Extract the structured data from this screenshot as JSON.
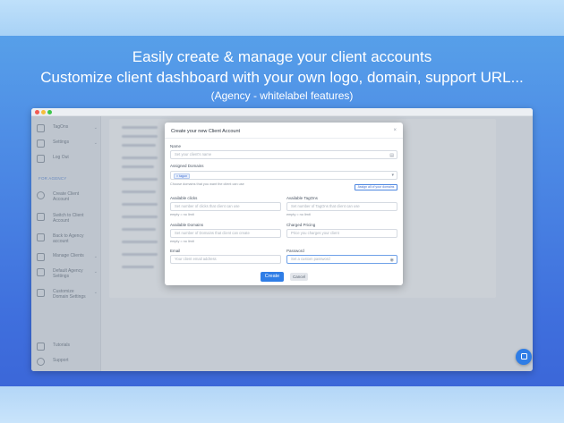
{
  "headline": {
    "line1": "Easily create & manage your client accounts",
    "line2": "Customize client dashboard with your own logo, domain, support URL...",
    "line3": "(Agency - whitelabel features)"
  },
  "sidebar": {
    "items_top": [
      {
        "label": "TagOns",
        "icon": "tag-icon",
        "chevron": "⌄"
      },
      {
        "label": "Settings",
        "icon": "gear-icon",
        "chevron": "⌄"
      },
      {
        "label": "Log Out",
        "icon": "logout-icon",
        "chevron": ""
      }
    ],
    "section_label": "FOR AGENCY",
    "items_agency": [
      {
        "label": "Create Client Account",
        "icon": "add-account-icon",
        "chevron": ""
      },
      {
        "label": "Switch to Client Account",
        "icon": "switch-icon",
        "chevron": ""
      },
      {
        "label": "Back to Agency account",
        "icon": "back-icon",
        "chevron": ""
      },
      {
        "label": "Manage Clients",
        "icon": "clients-icon",
        "chevron": "⌄"
      },
      {
        "label": "Default Agency Settings",
        "icon": "settings-icon",
        "chevron": "⌄"
      },
      {
        "label": "Customize Domain Settings",
        "icon": "domain-icon",
        "chevron": "⌄"
      }
    ],
    "items_bottom": [
      {
        "label": "Tutorials",
        "icon": "tutorials-icon"
      },
      {
        "label": "Support",
        "icon": "support-icon"
      }
    ]
  },
  "modal": {
    "title": "Create your new Client Account",
    "close": "×",
    "name_label": "Name",
    "name_placeholder": "Set your client's name",
    "domains_label": "Assigned Domains",
    "domains_tag": "× tagon",
    "domains_hint": "Choose domains that you want the client can use",
    "assign_all": "Assign all of your domains",
    "clicks_label": "Available clicks",
    "clicks_placeholder": "Set number of clicks that client can use",
    "clicks_hint": "empty = no limit",
    "tagons_label": "Available TagOns",
    "tagons_placeholder": "Set number of TagOns that client can use",
    "tagons_hint": "empty = no limit",
    "avail_domains_label": "Available Domains",
    "avail_domains_placeholder": "Set number of Domains that client can create",
    "avail_domains_hint": "empty = no limit",
    "pricing_label": "Charged Pricing",
    "pricing_placeholder": "Price you charges your client",
    "email_label": "Email",
    "email_placeholder": "Your client email address",
    "password_label": "Password",
    "password_placeholder": "Set a custom password",
    "create_button": "Create",
    "cancel_button": "Cancel"
  },
  "colors": {
    "accent": "#2f7de6",
    "background_top": "#5aa6ea",
    "background_bottom": "#3a63d6"
  }
}
